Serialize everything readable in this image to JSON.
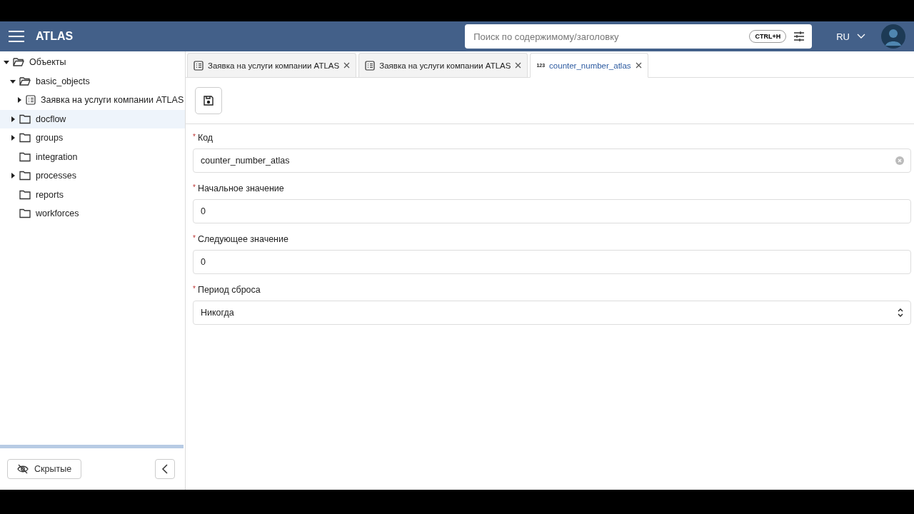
{
  "header": {
    "title": "ATLAS",
    "search": {
      "placeholder": "Поиск по содержимому/заголовку",
      "shortcut": "CTRL+H"
    },
    "language": "RU"
  },
  "sidebar": {
    "tree": [
      {
        "label": "Объекты",
        "kind": "folder",
        "expanded": true,
        "highlighted": false,
        "children": [
          {
            "label": "basic_objects",
            "kind": "folder",
            "expanded": true,
            "highlighted": false,
            "children": [
              {
                "label": "Заявка на услуги компании ATLAS",
                "kind": "document",
                "expanded": false,
                "highlighted": false
              }
            ]
          },
          {
            "label": "docflow",
            "kind": "folder",
            "expanded": false,
            "highlighted": true
          },
          {
            "label": "groups",
            "kind": "folder",
            "expanded": false,
            "highlighted": false
          },
          {
            "label": "integration",
            "kind": "folder",
            "highlighted": false
          },
          {
            "label": "processes",
            "kind": "folder",
            "expanded": false,
            "highlighted": false
          },
          {
            "label": "reports",
            "kind": "folder",
            "highlighted": false
          },
          {
            "label": "workforces",
            "kind": "folder",
            "highlighted": false
          }
        ]
      }
    ],
    "hidden_button": "Скрытые"
  },
  "tabs": [
    {
      "label": "Заявка на услуги компании ATLAS",
      "kind": "document",
      "selected": false
    },
    {
      "label": "Заявка на услуги компании ATLAS",
      "kind": "document",
      "selected": false
    },
    {
      "label": "counter_number_atlas",
      "kind": "counter",
      "icon_text": "123",
      "selected": true
    }
  ],
  "form": {
    "fields": [
      {
        "label": "Код",
        "kind": "text",
        "required_mark": "*",
        "value": "counter_number_atlas",
        "clearable": true
      },
      {
        "label": "Начальное значение",
        "kind": "text",
        "required_mark": "*",
        "value": "0"
      },
      {
        "label": "Следующее значение",
        "kind": "text",
        "required_mark": "*",
        "value": "0"
      },
      {
        "label": "Период сброса",
        "kind": "select",
        "required_mark": "*",
        "value": "Никогда"
      }
    ]
  }
}
